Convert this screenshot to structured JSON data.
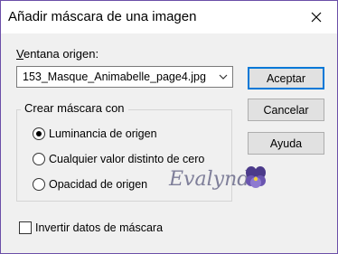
{
  "window": {
    "title": "Añadir máscara de una imagen"
  },
  "source": {
    "label": "Ventana origen:",
    "selected_value": "153_Masque_Animabelle_page4.jpg"
  },
  "buttons": {
    "ok": "Aceptar",
    "cancel": "Cancelar",
    "help": "Ayuda"
  },
  "mask_group": {
    "title": "Crear máscara con",
    "options": [
      {
        "label": "Luminancia de origen",
        "checked": true
      },
      {
        "label": "Cualquier valor distinto de cero",
        "checked": false
      },
      {
        "label": "Opacidad de origen",
        "checked": false
      }
    ]
  },
  "invert": {
    "label": "Invertir datos de máscara",
    "checked": false
  },
  "watermark": {
    "text": "Evalynda"
  },
  "colors": {
    "accent": "#0078d7",
    "frame": "#6b4fa8"
  }
}
